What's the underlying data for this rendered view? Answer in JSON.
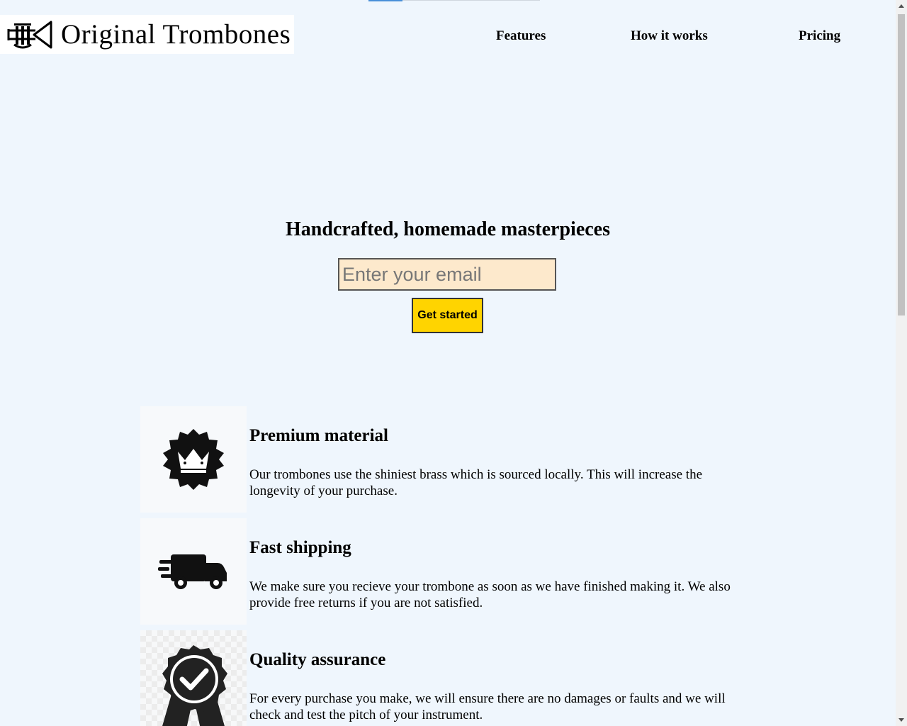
{
  "header": {
    "logo_text": "Original Trombones",
    "logo_icon": "trumpet-icon",
    "nav": [
      {
        "label": "Features"
      },
      {
        "label": "How it works"
      },
      {
        "label": "Pricing"
      }
    ]
  },
  "hero": {
    "title": "Handcrafted, homemade masterpieces",
    "email_placeholder": "Enter your email",
    "email_value": "",
    "cta_label": "Get started"
  },
  "features": [
    {
      "icon": "badge-crown-icon",
      "title": "Premium material",
      "description": "Our trombones use the shiniest brass which is sourced locally. This will increase the longevity of your purchase."
    },
    {
      "icon": "delivery-truck-icon",
      "title": "Fast shipping",
      "description": "We make sure you recieve your trombone as soon as we have finished making it. We also provide free returns if you are not satisfied."
    },
    {
      "icon": "award-ribbon-check-icon",
      "title": "Quality assurance",
      "description": "For every purchase you make, we will ensure there are no damages or faults and we will check and test the pitch of your instrument."
    }
  ],
  "colors": {
    "page_background": "#eff6fd",
    "input_background": "#fde9cc",
    "cta_background": "#ffd400"
  }
}
